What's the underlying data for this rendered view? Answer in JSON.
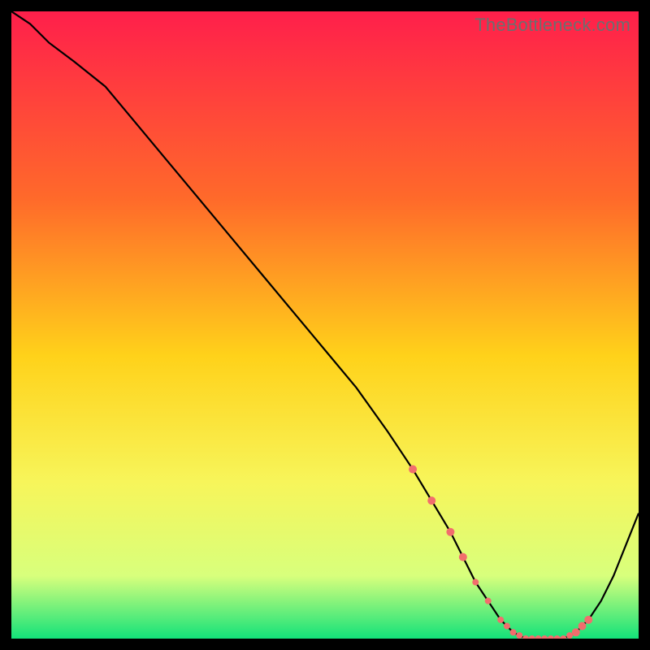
{
  "watermark": "TheBottleneck.com",
  "chart_data": {
    "type": "line",
    "title": "",
    "xlabel": "",
    "ylabel": "",
    "xlim": [
      0,
      100
    ],
    "ylim": [
      0,
      100
    ],
    "background_gradient": {
      "stops": [
        {
          "offset": 0,
          "color": "#ff1f4b"
        },
        {
          "offset": 30,
          "color": "#ff6a2a"
        },
        {
          "offset": 55,
          "color": "#ffd21a"
        },
        {
          "offset": 75,
          "color": "#f7f55a"
        },
        {
          "offset": 90,
          "color": "#d8ff7c"
        },
        {
          "offset": 100,
          "color": "#13e27a"
        }
      ]
    },
    "series": [
      {
        "name": "curve",
        "color": "#000000",
        "x": [
          0,
          3,
          6,
          10,
          15,
          20,
          25,
          30,
          35,
          40,
          45,
          50,
          55,
          60,
          64,
          67,
          70,
          72,
          74,
          76,
          78,
          80,
          82,
          84,
          86,
          88,
          90,
          92,
          94,
          96,
          98,
          100
        ],
        "values": [
          100,
          98,
          95,
          92,
          88,
          82,
          76,
          70,
          64,
          58,
          52,
          46,
          40,
          33,
          27,
          22,
          17,
          13,
          9,
          6,
          3,
          1,
          0,
          0,
          0,
          0,
          1,
          3,
          6,
          10,
          15,
          20
        ]
      }
    ],
    "scatter_points": {
      "name": "markers",
      "color": "#f26d6d",
      "radius_large": 6,
      "radius_small": 4,
      "points": [
        {
          "x": 64,
          "y": 27,
          "r": 5
        },
        {
          "x": 67,
          "y": 22,
          "r": 5
        },
        {
          "x": 70,
          "y": 17,
          "r": 5
        },
        {
          "x": 72,
          "y": 13,
          "r": 5
        },
        {
          "x": 74,
          "y": 9,
          "r": 4
        },
        {
          "x": 76,
          "y": 6,
          "r": 4
        },
        {
          "x": 78,
          "y": 3,
          "r": 4
        },
        {
          "x": 79,
          "y": 2,
          "r": 4
        },
        {
          "x": 80,
          "y": 1,
          "r": 4
        },
        {
          "x": 81,
          "y": 0.5,
          "r": 4
        },
        {
          "x": 82,
          "y": 0,
          "r": 4
        },
        {
          "x": 83,
          "y": 0,
          "r": 4
        },
        {
          "x": 84,
          "y": 0,
          "r": 4
        },
        {
          "x": 85,
          "y": 0,
          "r": 4
        },
        {
          "x": 86,
          "y": 0,
          "r": 4
        },
        {
          "x": 87,
          "y": 0,
          "r": 4
        },
        {
          "x": 88,
          "y": 0,
          "r": 4
        },
        {
          "x": 89,
          "y": 0.5,
          "r": 4
        },
        {
          "x": 90,
          "y": 1,
          "r": 5
        },
        {
          "x": 91,
          "y": 2,
          "r": 5
        },
        {
          "x": 92,
          "y": 3,
          "r": 5
        }
      ]
    }
  }
}
